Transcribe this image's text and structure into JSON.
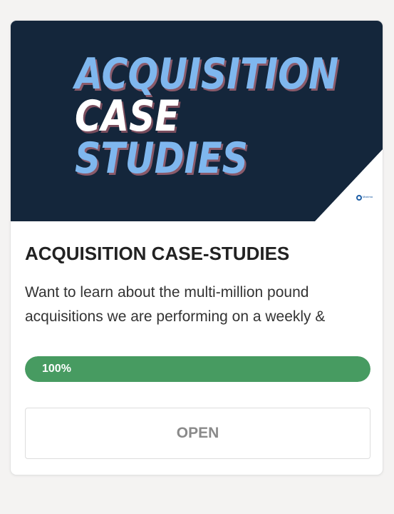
{
  "card": {
    "banner": {
      "line1": "ACQUISITION",
      "line2": "CASE",
      "line3": "STUDIES",
      "logo_text": "Maxima"
    },
    "title": "ACQUISITION CASE-STUDIES",
    "description": "Want to learn about the multi-million pound acquisitions we are performing on a weekly & monthly basis?",
    "progress": {
      "value": 100,
      "label": "100%"
    },
    "open_label": "OPEN"
  },
  "colors": {
    "banner_bg": "#14263b",
    "headline_blue": "#7fb7ee",
    "progress_green": "#479b61",
    "page_bg": "#f4f3f2"
  }
}
